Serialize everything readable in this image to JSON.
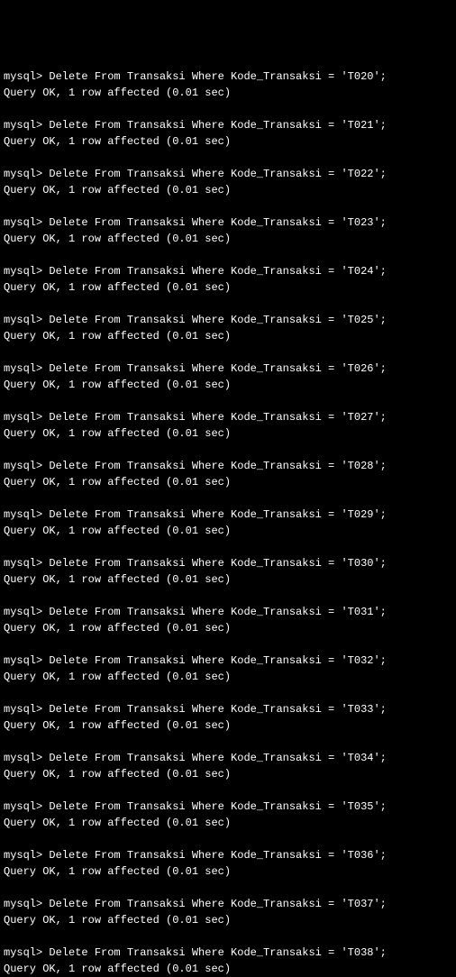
{
  "prompt": "mysql>",
  "command_prefix": "Delete From Transaksi Where Kode_Transaksi = ",
  "command_suffix": ";",
  "response": "Query OK, 1 row affected (0.01 sec)",
  "entries": [
    {
      "code": "'T020'"
    },
    {
      "code": "'T021'"
    },
    {
      "code": "'T022'"
    },
    {
      "code": "'T023'"
    },
    {
      "code": "'T024'"
    },
    {
      "code": "'T025'"
    },
    {
      "code": "'T026'"
    },
    {
      "code": "'T027'"
    },
    {
      "code": "'T028'"
    },
    {
      "code": "'T029'"
    },
    {
      "code": "'T030'"
    },
    {
      "code": "'T031'"
    },
    {
      "code": "'T032'"
    },
    {
      "code": "'T033'"
    },
    {
      "code": "'T034'"
    },
    {
      "code": "'T035'"
    },
    {
      "code": "'T036'"
    },
    {
      "code": "'T037'"
    },
    {
      "code": "'T038'"
    }
  ]
}
